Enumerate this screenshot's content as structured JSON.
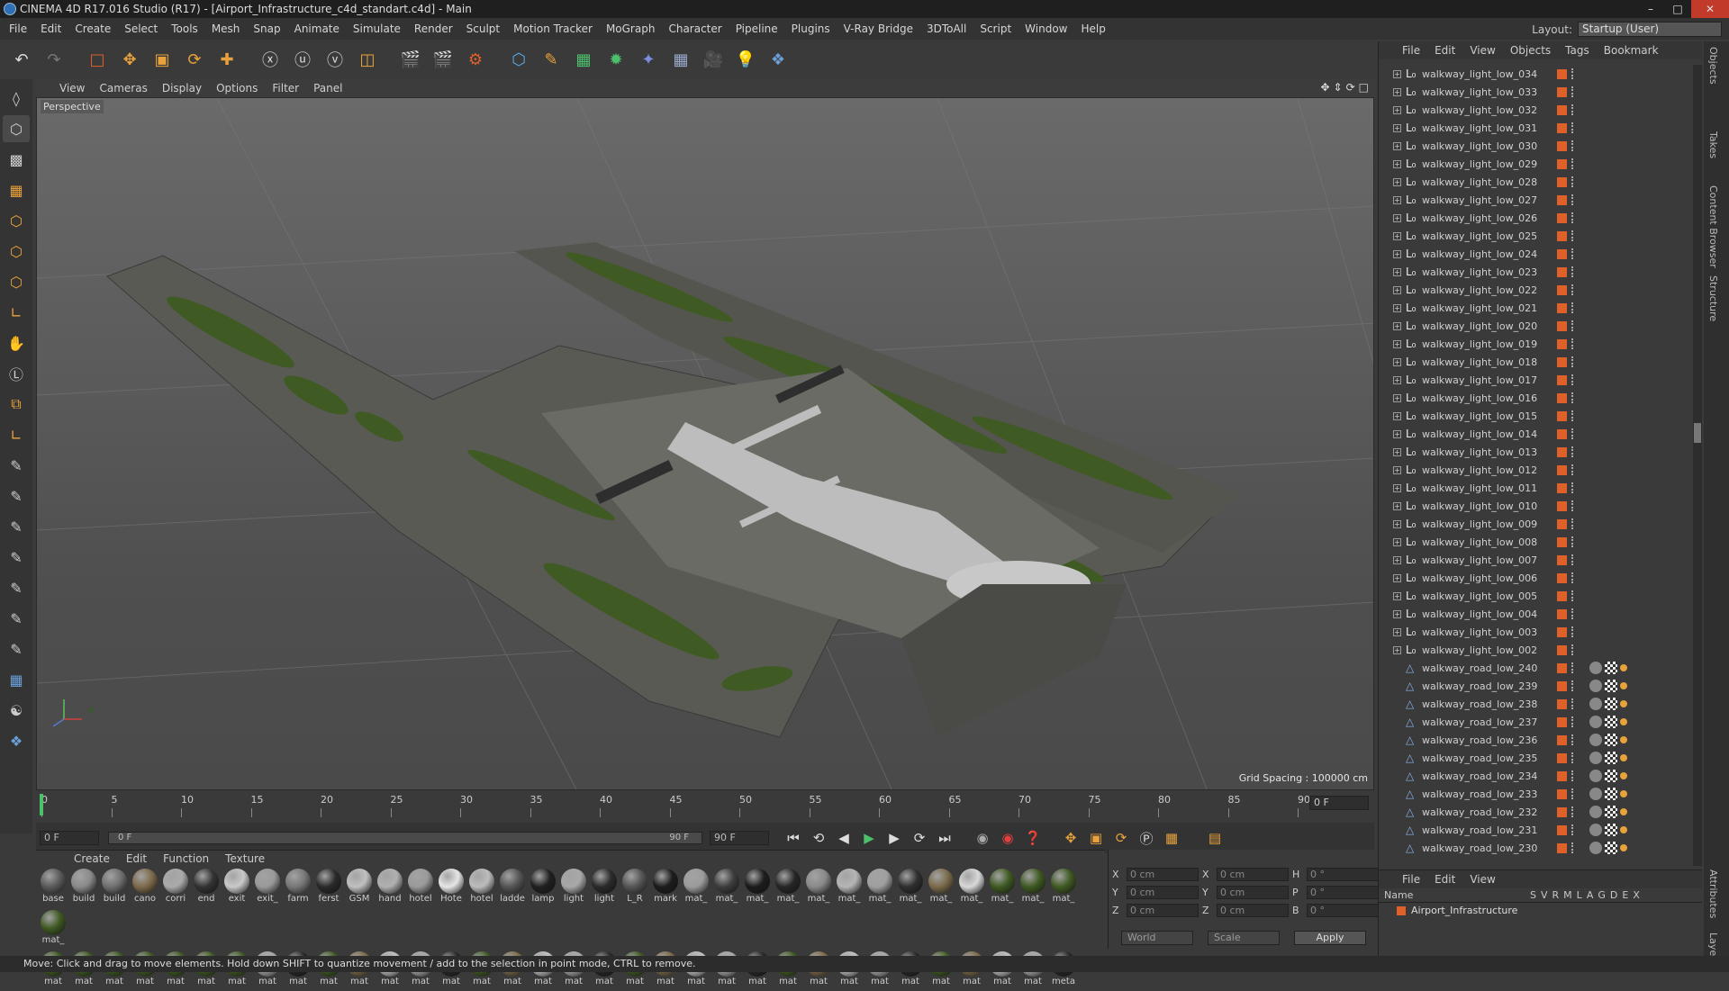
{
  "window": {
    "title": "CINEMA 4D R17.016 Studio (R17) - [Airport_Infrastructure_c4d_standart.c4d] - Main"
  },
  "menu": [
    "File",
    "Edit",
    "Create",
    "Select",
    "Tools",
    "Mesh",
    "Snap",
    "Animate",
    "Simulate",
    "Render",
    "Sculpt",
    "Motion Tracker",
    "MoGraph",
    "Character",
    "Pipeline",
    "Plugins",
    "V-Ray Bridge",
    "3DToAll",
    "Script",
    "Window",
    "Help"
  ],
  "layout": {
    "label": "Layout:",
    "value": "Startup (User)"
  },
  "viewport": {
    "menu": [
      "View",
      "Cameras",
      "Display",
      "Options",
      "Filter",
      "Panel"
    ],
    "label": "Perspective",
    "grid_spacing": "Grid Spacing : 100000 cm"
  },
  "timeline": {
    "ticks": [
      "0",
      "5",
      "10",
      "15",
      "20",
      "25",
      "30",
      "35",
      "40",
      "45",
      "50",
      "55",
      "60",
      "65",
      "70",
      "75",
      "80",
      "85",
      "90"
    ],
    "current": "0 F",
    "start": "0 F",
    "range_start": "0 F",
    "range_end": "90 F",
    "end": "90 F",
    "end_field": "90 F"
  },
  "materials": {
    "menu": [
      "Create",
      "Edit",
      "Function",
      "Texture"
    ],
    "row1": [
      "base",
      "build",
      "build",
      "cano",
      "corri",
      "end",
      "exit",
      "exit_",
      "farm",
      "ferst",
      "GSM",
      "hand",
      "hotel",
      "Hote",
      "hotel",
      "ladde",
      "lamp",
      "light",
      "light",
      "L_R",
      "mark",
      "mat_",
      "mat_",
      "mat_",
      "mat_",
      "mat_",
      "mat_",
      "mat_",
      "mat_",
      "mat_",
      "mat_",
      "mat_",
      "mat_",
      "mat_",
      "mat_"
    ],
    "row2": [
      "mat",
      "mat",
      "mat",
      "mat",
      "mat",
      "mat",
      "mat",
      "mat",
      "mat",
      "mat",
      "mat",
      "mat",
      "mat",
      "mat",
      "mat",
      "mat",
      "mat",
      "mat",
      "mat",
      "mat",
      "mat",
      "mat",
      "mat",
      "mat",
      "mat",
      "mat",
      "mat",
      "mat",
      "mat",
      "mat",
      "mat",
      "mat",
      "mat",
      "meta"
    ]
  },
  "coords": {
    "x": "X",
    "y": "Y",
    "z": "Z",
    "h": "H",
    "p": "P",
    "b": "B",
    "val_cm": "0 cm",
    "val_deg": "0 °",
    "world": "World",
    "scale": "Scale",
    "apply": "Apply"
  },
  "objects": {
    "menu": [
      "File",
      "Edit",
      "View",
      "Objects",
      "Tags",
      "Bookmark"
    ],
    "lights": [
      "walkway_light_low_034",
      "walkway_light_low_033",
      "walkway_light_low_032",
      "walkway_light_low_031",
      "walkway_light_low_030",
      "walkway_light_low_029",
      "walkway_light_low_028",
      "walkway_light_low_027",
      "walkway_light_low_026",
      "walkway_light_low_025",
      "walkway_light_low_024",
      "walkway_light_low_023",
      "walkway_light_low_022",
      "walkway_light_low_021",
      "walkway_light_low_020",
      "walkway_light_low_019",
      "walkway_light_low_018",
      "walkway_light_low_017",
      "walkway_light_low_016",
      "walkway_light_low_015",
      "walkway_light_low_014",
      "walkway_light_low_013",
      "walkway_light_low_012",
      "walkway_light_low_011",
      "walkway_light_low_010",
      "walkway_light_low_009",
      "walkway_light_low_008",
      "walkway_light_low_007",
      "walkway_light_low_006",
      "walkway_light_low_005",
      "walkway_light_low_004",
      "walkway_light_low_003",
      "walkway_light_low_002"
    ],
    "roads": [
      "walkway_road_low_240",
      "walkway_road_low_239",
      "walkway_road_low_238",
      "walkway_road_low_237",
      "walkway_road_low_236",
      "walkway_road_low_235",
      "walkway_road_low_234",
      "walkway_road_low_233",
      "walkway_road_low_232",
      "walkway_road_low_231",
      "walkway_road_low_230"
    ]
  },
  "attributes": {
    "menu": [
      "File",
      "Edit",
      "View"
    ],
    "name_header": "Name",
    "cols": [
      "S",
      "V",
      "R",
      "M",
      "L",
      "A",
      "G",
      "D",
      "E",
      "X"
    ],
    "item": "Airport_Infrastructure"
  },
  "sidetabs": [
    "Objects",
    "Takes",
    "Content Browser",
    "Structure",
    "Attributes",
    "Layers"
  ],
  "status": "Move: Click and drag to move elements. Hold down SHIFT to quantize movement / add to the selection in point mode, CTRL to remove.",
  "colors": {
    "accent": "#e0602a",
    "viewport_bg": "#5e5e5e",
    "grass": "#3f5a22"
  }
}
